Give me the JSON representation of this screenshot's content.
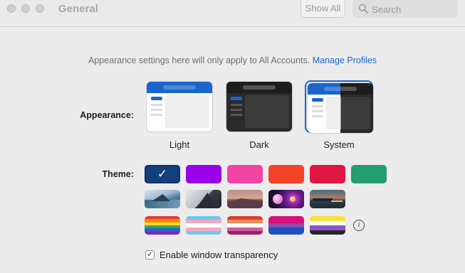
{
  "window": {
    "title": "General",
    "show_all_label": "Show All",
    "search_placeholder": "Search"
  },
  "info": {
    "text": "Appearance settings here will only apply to All Accounts.",
    "link": "Manage Profiles"
  },
  "appearance": {
    "label": "Appearance:",
    "options": [
      {
        "label": "Light",
        "selected": false
      },
      {
        "label": "Dark",
        "selected": false
      },
      {
        "label": "System",
        "selected": true
      }
    ]
  },
  "theme": {
    "label": "Theme:",
    "colors": [
      "#123e7c",
      "#9a00e8",
      "#f244a4",
      "#f5432a",
      "#e01743",
      "#239e6c"
    ],
    "selected_index": 0,
    "photo_themes": [
      "coastline",
      "mountain-peak",
      "desert-sunset",
      "cosmic-orbs",
      "harbor-dusk"
    ],
    "flag_themes": [
      "rainbow-pride",
      "transgender-pride",
      "lesbian-pride",
      "bisexual-pride",
      "nonbinary-pride"
    ]
  },
  "transparency": {
    "label": "Enable window transparency",
    "checked": true
  }
}
